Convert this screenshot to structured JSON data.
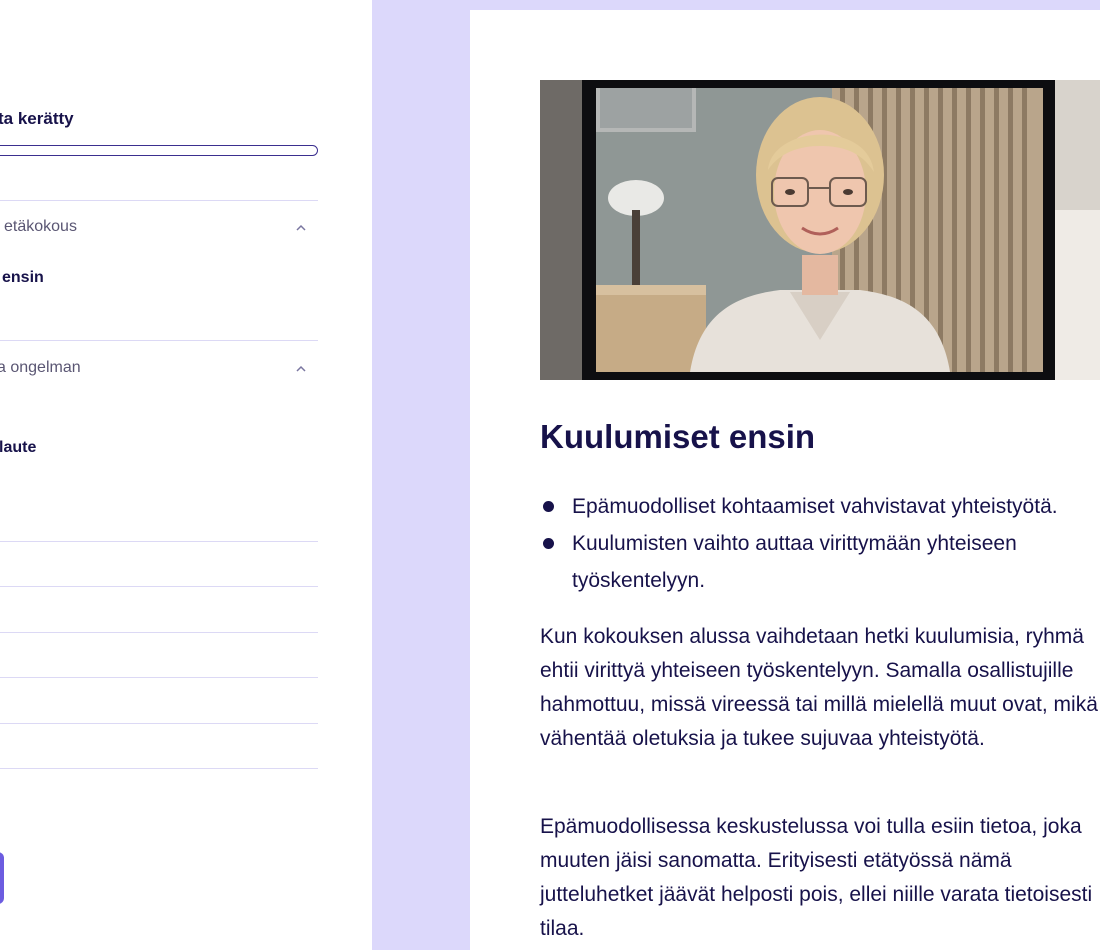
{
  "sidebar": {
    "progress_title": "ta kerätty",
    "progress_value_percent": 0,
    "sections": [
      {
        "label": "etäkokous",
        "items": [
          "ensin"
        ]
      },
      {
        "label": "a ongelman",
        "items": [
          "laute"
        ]
      }
    ]
  },
  "lesson": {
    "video_description": "Woman with glasses smiling during a video call",
    "title": "Kuulumiset ensin",
    "bullets": [
      "Epämuodolliset kohtaamiset vahvistavat yhteistyötä.",
      "Kuulumisten vaihto auttaa virittymään yhteiseen työskentelyyn."
    ],
    "paragraphs": [
      "Kun kokouksen alussa vaihdetaan hetki kuulumisia, ryhmä ehtii virittyä yhteiseen työskentelyyn. Samalla osallistujille hahmottuu, missä vireessä tai millä mielellä muut ovat, mikä vähentää oletuksia ja tukee sujuvaa yhteistyötä.",
      "Epämuodollisessa keskustelussa voi tulla esiin tietoa, joka muuten jäisi sanomatta. Erityisesti etätyössä nämä jutteluhetket jäävät helposti pois, ellei niille varata tietoisesti tilaa."
    ]
  },
  "colors": {
    "lavender_background": "#dcd8fb",
    "text_navy": "#17124a",
    "accent_purple": "#6c5ce0",
    "divider": "#dcd9f5"
  }
}
